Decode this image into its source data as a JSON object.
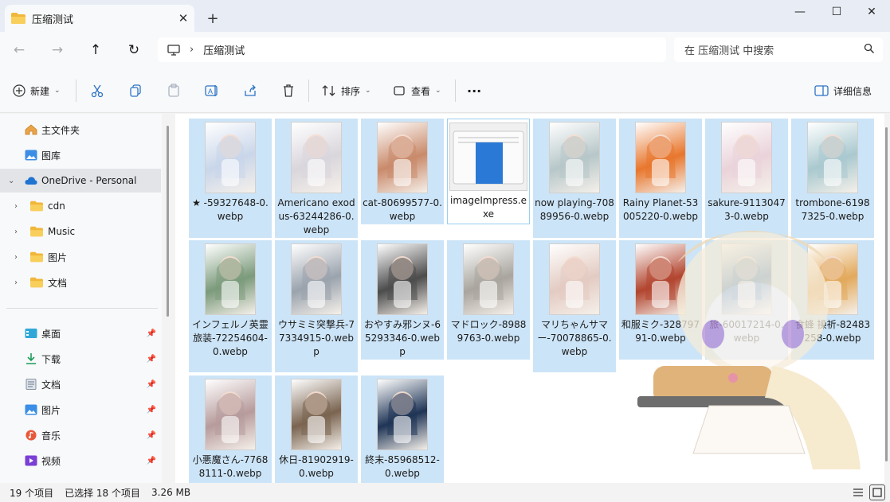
{
  "tab": {
    "title": "压缩测试",
    "close": "✕",
    "new_tab": "+"
  },
  "window_controls": {
    "minimize": "—",
    "maximize": "☐",
    "close": "✕"
  },
  "address": {
    "path": "压缩测试",
    "search_placeholder": "在 压缩测试 中搜索"
  },
  "toolbar": {
    "new_label": "新建",
    "sort_label": "排序",
    "view_label": "查看",
    "more": "···",
    "details_label": "详细信息"
  },
  "sidebar": {
    "items": [
      {
        "label": "主文件夹",
        "icon": "home-icon"
      },
      {
        "label": "图库",
        "icon": "gallery-icon"
      },
      {
        "label": "OneDrive - Personal",
        "icon": "cloud-icon"
      },
      {
        "label": "cdn",
        "icon": "folder-icon"
      },
      {
        "label": "Music",
        "icon": "folder-icon"
      },
      {
        "label": "图片",
        "icon": "folder-icon"
      },
      {
        "label": "文档",
        "icon": "folder-icon"
      }
    ],
    "quick": [
      {
        "label": "桌面",
        "icon": "desktop-icon"
      },
      {
        "label": "下载",
        "icon": "download-icon"
      },
      {
        "label": "文档",
        "icon": "document-icon"
      },
      {
        "label": "图片",
        "icon": "pictures-icon"
      },
      {
        "label": "音乐",
        "icon": "music-icon"
      },
      {
        "label": "视频",
        "icon": "video-icon"
      }
    ]
  },
  "files": [
    {
      "name": "★ -59327648-0.webp",
      "color": "#c9d6ea"
    },
    {
      "name": "Americano exodus-63244286-0.webp",
      "color": "#d9d6dc"
    },
    {
      "name": "cat-80699577-0.webp",
      "color": "#c98a6b"
    },
    {
      "name": "imageImpress.exe",
      "color": "#2b79d6"
    },
    {
      "name": "now playing-70889956-0.webp",
      "color": "#b7c7c9"
    },
    {
      "name": "Rainy Planet-53005220-0.webp",
      "color": "#e8772e"
    },
    {
      "name": "sakure-91130473-0.webp",
      "color": "#ead3da"
    },
    {
      "name": "trombone-61987325-0.webp",
      "color": "#a9c9cf"
    },
    {
      "name": "インフェルノ英靈旅装-72254604-0.webp",
      "color": "#7b9a7b"
    },
    {
      "name": "ウサミミ突撃兵-77334915-0.webp",
      "color": "#9aa3ad"
    },
    {
      "name": "おやすみ邪ンヌ-65293346-0.webp",
      "color": "#4c4c4c"
    },
    {
      "name": "マドロック-89889763-0.webp",
      "color": "#a9a59e"
    },
    {
      "name": "マリちゃんサマー-70078865-0.webp",
      "color": "#e3cbc2"
    },
    {
      "name": "和服ミク-32879791-0.webp",
      "color": "#b2452f"
    },
    {
      "name": "旅-60017214-0.webp",
      "color": "#4f86b7"
    },
    {
      "name": "食蜂 操祈-82483258-0.webp",
      "color": "#e2a95c"
    },
    {
      "name": "小悪魔さん-77688111-0.webp",
      "color": "#b79b9c"
    },
    {
      "name": "休日-81902919-0.webp",
      "color": "#7a6450"
    },
    {
      "name": "終末-85968512-0.webp",
      "color": "#1f3556"
    }
  ],
  "status": {
    "count": "19 个项目",
    "selected": "已选择 18 个项目",
    "size": "3.26 MB"
  }
}
